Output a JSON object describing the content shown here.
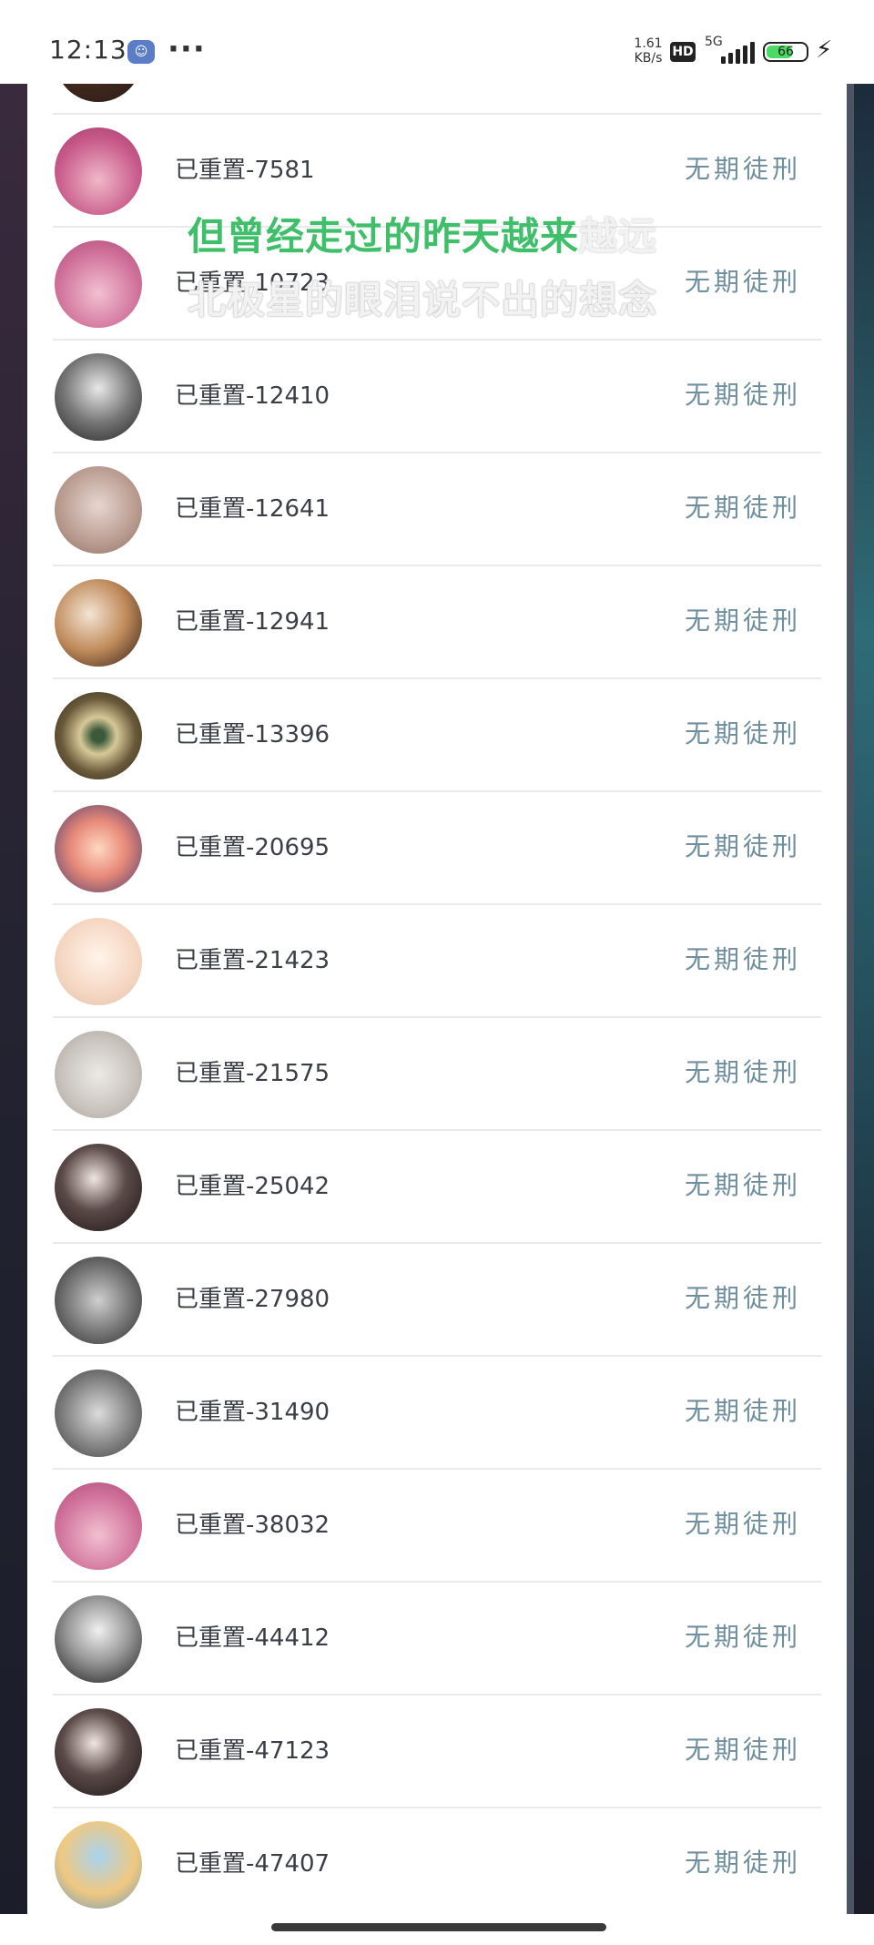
{
  "status_bar": {
    "time": "12:13",
    "net_speed": "1.61 KB/s",
    "hd_label": "HD",
    "network_label": "5G",
    "battery_level": "66",
    "battery_fraction": 0.66
  },
  "lyrics": {
    "line1_sung": "但曾经走过的昨天越来",
    "line1_unsung": "越远",
    "line2": "北极星的眼泪说不出的想念"
  },
  "list": {
    "items": [
      {
        "name": "",
        "status": ""
      },
      {
        "name": "已重置-7581",
        "status": "无期徒刑"
      },
      {
        "name": "已重置-10723",
        "status": "无期徒刑"
      },
      {
        "name": "已重置-12410",
        "status": "无期徒刑"
      },
      {
        "name": "已重置-12641",
        "status": "无期徒刑"
      },
      {
        "name": "已重置-12941",
        "status": "无期徒刑"
      },
      {
        "name": "已重置-13396",
        "status": "无期徒刑"
      },
      {
        "name": "已重置-20695",
        "status": "无期徒刑"
      },
      {
        "name": "已重置-21423",
        "status": "无期徒刑"
      },
      {
        "name": "已重置-21575",
        "status": "无期徒刑"
      },
      {
        "name": "已重置-25042",
        "status": "无期徒刑"
      },
      {
        "name": "已重置-27980",
        "status": "无期徒刑"
      },
      {
        "name": "已重置-31490",
        "status": "无期徒刑"
      },
      {
        "name": "已重置-38032",
        "status": "无期徒刑"
      },
      {
        "name": "已重置-44412",
        "status": "无期徒刑"
      },
      {
        "name": "已重置-47123",
        "status": "无期徒刑"
      },
      {
        "name": "已重置-47407",
        "status": "无期徒刑"
      },
      {
        "name": "",
        "status": ""
      }
    ]
  },
  "colors": {
    "status_text": "#6f8e9e",
    "lyric_highlight": "#3fbf6a",
    "divider": "#e9eaec"
  }
}
